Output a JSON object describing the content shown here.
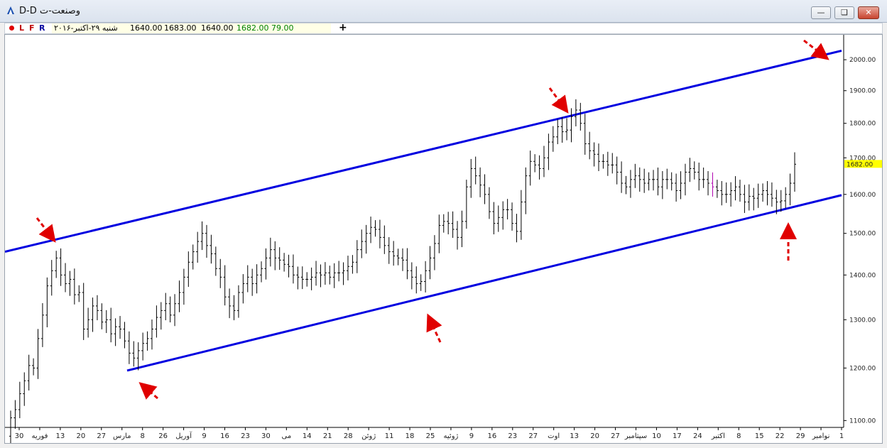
{
  "window": {
    "title": "وصنعت-ت D-D",
    "minimize_icon": "minimize-icon",
    "restore_icon": "restore-icon",
    "close_icon": "close-icon"
  },
  "toolbar": {
    "buttons": [
      "L",
      "F",
      "R"
    ],
    "date": "شنبه ۲۹-اکتبر-۲۰۱۶",
    "open": "1640.00",
    "high": "1683.00",
    "low": "1640.00",
    "close": "1682.00",
    "volume": "79.00",
    "plus": "+"
  },
  "colors": {
    "channel": "#0000e0",
    "arrow": "#e00000",
    "bar": "#000000",
    "highlight_bar": "#b000b0",
    "last_price_badge": "#ffff00"
  },
  "chart_data": {
    "type": "ohlc",
    "y_ticks": [
      "1100.00",
      "1200.00",
      "1300.00",
      "1400.00",
      "1500.00",
      "1600.00",
      "1700.00",
      "1800.00",
      "1900.00",
      "2000.00"
    ],
    "y_scale": "log",
    "ylim": [
      1085,
      2060
    ],
    "x_ticks": [
      "30",
      "فوریه",
      "13",
      "20",
      "27",
      "مارس",
      "8",
      "26",
      "آوریل",
      "9",
      "16",
      "23",
      "30",
      "می",
      "14",
      "21",
      "28",
      "ژوئن",
      "11",
      "18",
      "25",
      "ژوئیه",
      "9",
      "16",
      "23",
      "27",
      "اوت",
      "13",
      "20",
      "27",
      "سپتامبر",
      "10",
      "17",
      "24",
      "اکتبر",
      "8",
      "15",
      "22",
      "29",
      "نوامبر",
      "1"
    ],
    "last_price": "1682.00",
    "channel_upper": [
      [
        0,
        1455
      ],
      [
        1178,
        2030
      ]
    ],
    "channel_lower": [
      [
        172,
        1195
      ],
      [
        1178,
        1598
      ]
    ],
    "closes": [
      1105,
      1120,
      1150,
      1175,
      1205,
      1200,
      1260,
      1310,
      1375,
      1410,
      1440,
      1400,
      1380,
      1390,
      1355,
      1360,
      1280,
      1300,
      1330,
      1320,
      1295,
      1300,
      1270,
      1285,
      1280,
      1255,
      1230,
      1220,
      1235,
      1250,
      1260,
      1280,
      1305,
      1320,
      1335,
      1310,
      1335,
      1360,
      1395,
      1430,
      1455,
      1480,
      1500,
      1470,
      1450,
      1415,
      1395,
      1350,
      1330,
      1320,
      1360,
      1380,
      1395,
      1380,
      1400,
      1415,
      1440,
      1460,
      1440,
      1435,
      1425,
      1420,
      1400,
      1395,
      1390,
      1390,
      1395,
      1405,
      1400,
      1405,
      1395,
      1405,
      1405,
      1410,
      1420,
      1430,
      1460,
      1480,
      1500,
      1515,
      1510,
      1490,
      1470,
      1455,
      1445,
      1440,
      1435,
      1410,
      1395,
      1380,
      1385,
      1410,
      1440,
      1475,
      1520,
      1530,
      1525,
      1510,
      1490,
      1530,
      1620,
      1670,
      1650,
      1625,
      1600,
      1555,
      1525,
      1540,
      1560,
      1560,
      1525,
      1505,
      1580,
      1650,
      1690,
      1680,
      1670,
      1700,
      1745,
      1760,
      1790,
      1775,
      1780,
      1820,
      1840,
      1800,
      1740,
      1720,
      1710,
      1690,
      1690,
      1680,
      1680,
      1660,
      1630,
      1620,
      1640,
      1650,
      1640,
      1630,
      1640,
      1640,
      1620,
      1640,
      1640,
      1630,
      1610,
      1630,
      1660,
      1670,
      1660,
      1640,
      1640,
      1630,
      1620,
      1610,
      1600,
      1600,
      1610,
      1620,
      1600,
      1580,
      1595,
      1590,
      1600,
      1610,
      1600,
      1590,
      1580,
      1583,
      1600,
      1630,
      1682
    ],
    "highlight_bar_index": 154
  }
}
